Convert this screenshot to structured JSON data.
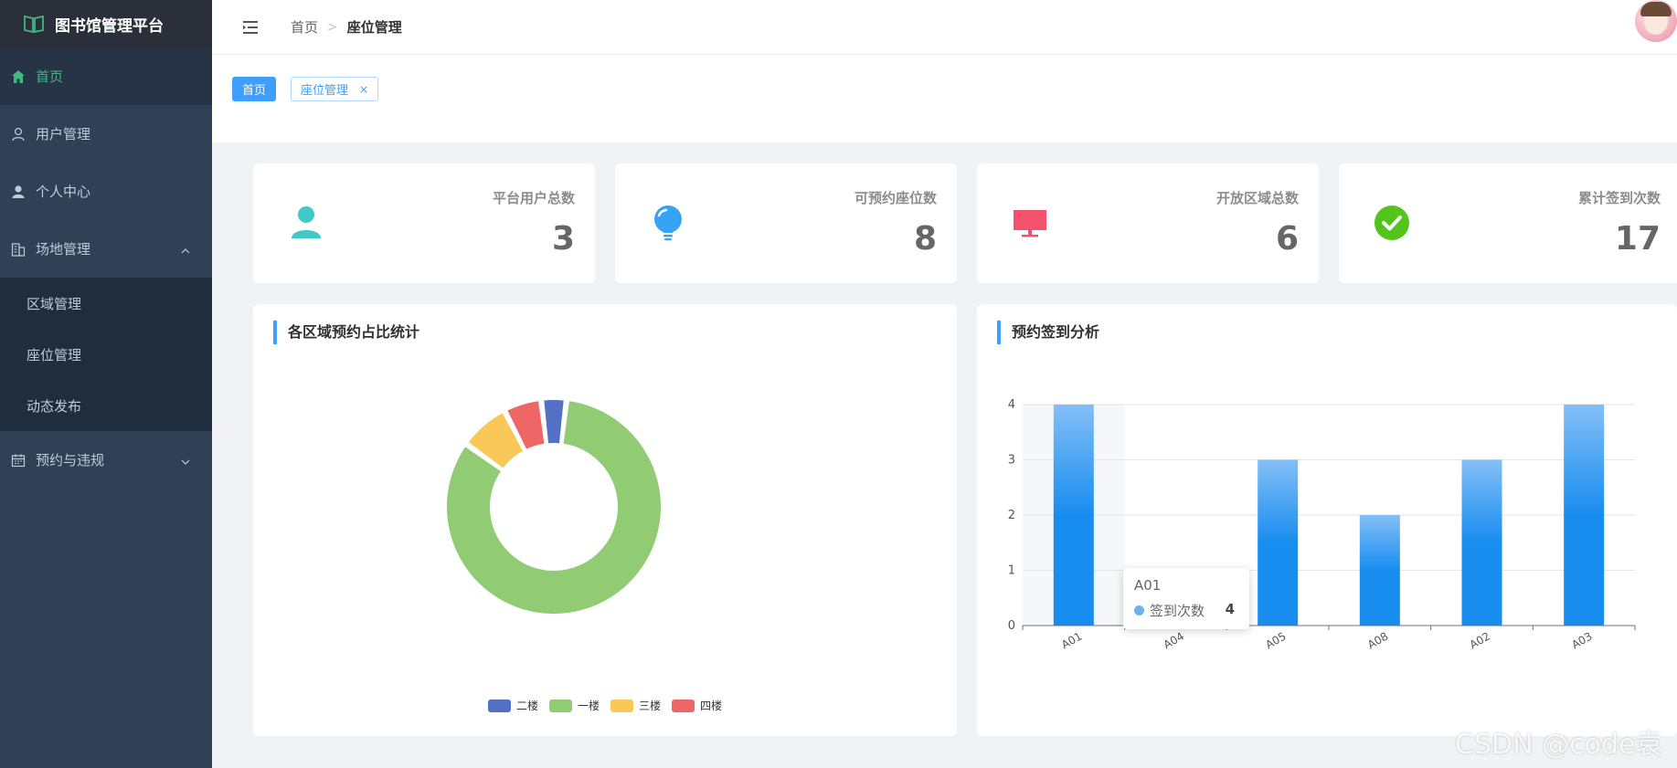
{
  "app": {
    "title": "图书馆管理平台"
  },
  "sidebar": {
    "items": [
      {
        "label": "首页",
        "icon": "home-icon",
        "active": true
      },
      {
        "label": "用户管理",
        "icon": "user-outline-icon"
      },
      {
        "label": "个人中心",
        "icon": "user-solid-icon"
      },
      {
        "label": "场地管理",
        "icon": "building-icon",
        "expanded": true
      },
      {
        "label": "预约与违规",
        "icon": "calendar-icon",
        "expanded": false
      }
    ],
    "submenu": [
      {
        "label": "区域管理"
      },
      {
        "label": "座位管理"
      },
      {
        "label": "动态发布"
      }
    ]
  },
  "header": {
    "breadcrumb": {
      "home": "首页",
      "separator": ">",
      "current": "座位管理"
    }
  },
  "tags": {
    "home": "首页",
    "seat": "座位管理",
    "close": "×"
  },
  "stats": [
    {
      "label": "平台用户总数",
      "value": "3",
      "icon": "user-icon",
      "color": "#40c9c6"
    },
    {
      "label": "可预约座位数",
      "value": "8",
      "icon": "bulb-icon",
      "color": "#36a3f7"
    },
    {
      "label": "开放区域总数",
      "value": "6",
      "icon": "monitor-icon",
      "color": "#f4516c"
    },
    {
      "label": "累计签到次数",
      "value": "17",
      "icon": "check-circle-icon",
      "color": "#52c41a"
    }
  ],
  "panels": {
    "pie_title": "各区域预约占比统计",
    "bar_title": "预约签到分析"
  },
  "chart_data": [
    {
      "type": "pie",
      "title": "各区域预约占比统计",
      "variant": "donut",
      "series": [
        {
          "name": "二楼",
          "value": 1,
          "color": "#5470c6"
        },
        {
          "name": "一楼",
          "value": 22,
          "color": "#91cc75"
        },
        {
          "name": "三楼",
          "value": 2,
          "color": "#fac858"
        },
        {
          "name": "四楼",
          "value": 1.5,
          "color": "#ee6666"
        }
      ],
      "legend_position": "bottom"
    },
    {
      "type": "bar",
      "title": "预约签到分析",
      "categories": [
        "A01",
        "A04",
        "A05",
        "A08",
        "A02",
        "A03"
      ],
      "series": [
        {
          "name": "签到次数",
          "values": [
            4,
            1,
            3,
            2,
            3,
            4
          ]
        }
      ],
      "ylim": [
        0,
        4
      ],
      "yticks": [
        "0",
        "1",
        "2",
        "3",
        "4"
      ],
      "grid": true,
      "color_top": "#83bff6",
      "color_mid": "#188df0",
      "tooltip": {
        "category": "A01",
        "series": "签到次数",
        "value": "4"
      }
    }
  ],
  "watermark": "CSDN @code袁"
}
